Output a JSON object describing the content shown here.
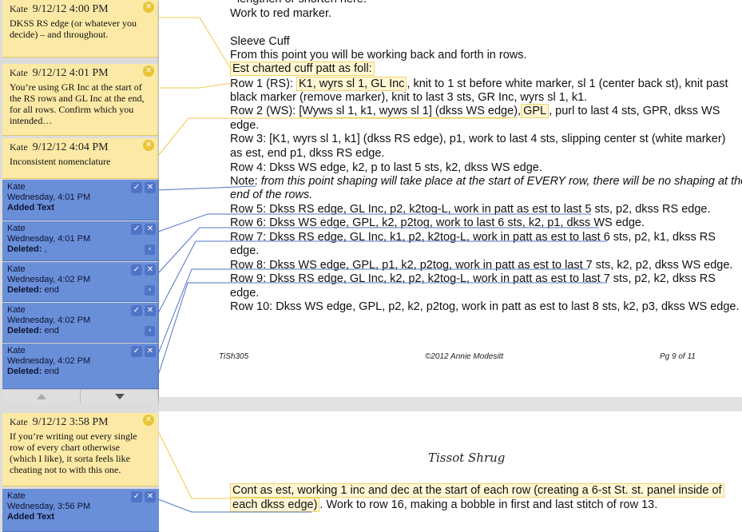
{
  "comments": [
    {
      "author": "Kate",
      "date": "9/12/12 4:00 PM",
      "text": "DKSS RS edge (or whatever you decide) – and throughout."
    },
    {
      "author": "Kate",
      "date": "9/12/12 4:01 PM",
      "text": "You’re using GR Inc at the start of the RS rows and GL Inc at the end, for all rows. Confirm which you intended…"
    },
    {
      "author": "Kate",
      "date": "9/12/12 4:04 PM",
      "text": "Inconsistent nomenclature"
    }
  ],
  "changes": [
    {
      "author": "Kate",
      "date": "Wednesday, 4:01 PM",
      "kind": "Added Text",
      "value": ""
    },
    {
      "author": "Kate",
      "date": "Wednesday, 4:01 PM",
      "kind": "Deleted:",
      "value": ","
    },
    {
      "author": "Kate",
      "date": "Wednesday, 4:02 PM",
      "kind": "Deleted:",
      "value": "end"
    },
    {
      "author": "Kate",
      "date": "Wednesday, 4:02 PM",
      "kind": "Deleted:",
      "value": "end"
    },
    {
      "author": "Kate",
      "date": "Wednesday, 4:02 PM",
      "kind": "Deleted:",
      "value": "end"
    }
  ],
  "lower_comment": {
    "author": "Kate",
    "date": "9/12/12 3:58 PM",
    "text": "If you’re writing out every single row of every chart otherwise (which I like), it sorta feels like cheating not to with this one."
  },
  "lower_change": {
    "author": "Kate",
    "date": "Wednesday, 3:56 PM",
    "kind": "Added Text"
  },
  "doc_lines": {
    "l0": "- lengthen or shorten here.",
    "l1": "Work to red marker.",
    "l2": "Sleeve Cuff",
    "l3": "From this point you will be working back and forth in rows.",
    "l4": "Est charted cuff patt as foll:",
    "l5a": "Row 1 (RS): ",
    "l5b": "K1, wyrs sl 1, GL Inc",
    "l5c": ", knit to 1 st before white marker, sl 1 (center back st), knit past",
    "l6": "black marker (remove marker), knit to last 3 sts, GR Inc, wyrs sl 1, k1.",
    "l7a": "Row 2 (WS): ",
    "l7b": "[Wyws sl 1, k1, wyws sl 1] (dkss WS edge)",
    "l7c": ",",
    "l7d": "GPL",
    "l7e": ", purl to last 4 sts, GPR, dkss WS",
    "l8": "edge.",
    "l9": "Row 3: [K1, wyrs sl 1, k1] (dkss RS edge), p1, work to last 4 sts, slipping center st (white marker)",
    "l10": "as est, end p1, dkss RS edge.",
    "l11": "Row 4: Dkss WS edge, k2, p to last 5 sts, k2, dkss WS edge.",
    "l12a": "Note:",
    "l12b": " from this point shaping will take place at the start of EVERY row, there will be no shaping at the",
    "l13": "end of the rows.",
    "l14": "Row 5: Dkss RS edge, GL Inc, p2, k2tog-L, work in patt as est to last 5 sts, p2, dkss RS edge.",
    "l15": "Row 6: Dkss WS edge, GPL, k2, p2tog, work to last 6 sts, k2, p1, dkss WS edge.",
    "l16": "Row 7: Dkss RS edge, GL Inc, k1, p2, k2tog-L, work in patt as est to last 6 sts, p2, k1, dkss RS",
    "l17": "edge.",
    "l18": "Row 8: Dkss WS edge, GPL, p1, k2, p2tog, work in patt as est to last 7 sts, k2, p2, dkss WS edge.",
    "l19": "Row 9: Dkss RS edge, GL Inc, k2, p2, k2tog-L, work in patt as est to last 7 sts, p2, k2, dkss RS",
    "l20": "edge.",
    "l21": "Row 10: Dkss WS edge, GPL, p2, k2, p2tog, work in patt as est to last 8 sts, k2, p3, dkss WS edge."
  },
  "footer": {
    "left": "TiSh305",
    "center": "©2012 Annie Modesitt",
    "right": "Pg 9 of 11"
  },
  "page2": {
    "title": "Tissot Shrug",
    "line1": "Cont as est, working 1 inc and dec at the start of each row (creating a 6-st St. st. panel inside of",
    "line2a": "each dkss edge)",
    "line2b": ". Work to row 16, making a bobble in first and last stitch of row 13."
  },
  "icons": {
    "accept": "check-icon",
    "reject": "x-icon",
    "close": "close-circle-icon",
    "collapse": "chevron-left-icon",
    "scroll_up": "triangle-up-icon",
    "scroll_down": "triangle-down-icon"
  },
  "colors": {
    "comment_bg": "#fbe9a5",
    "change_bg": "#6a8fd9",
    "highlight_border": "#f2d36a"
  }
}
